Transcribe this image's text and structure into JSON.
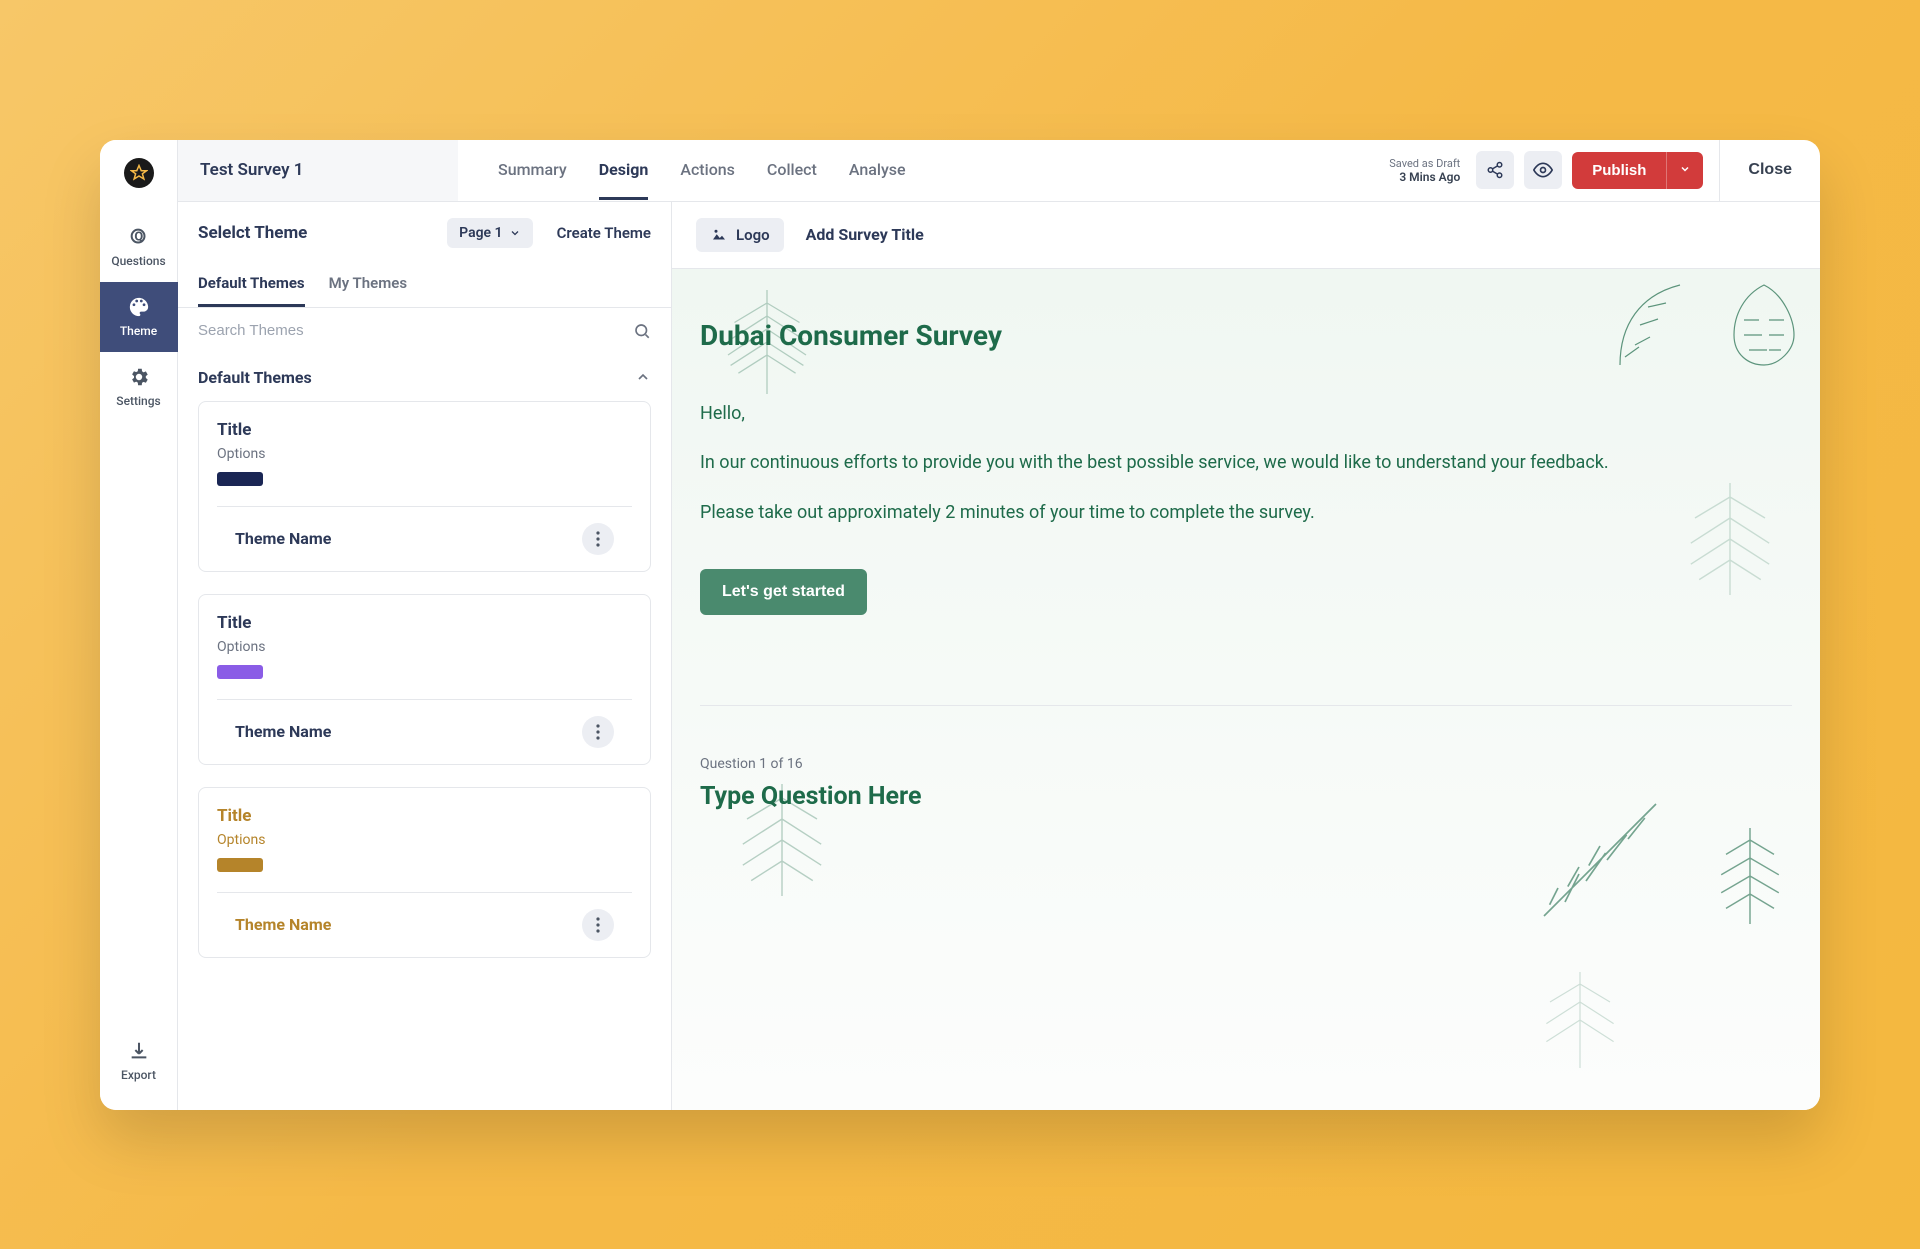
{
  "survey_name": "Test Survey 1",
  "top_tabs": [
    "Summary",
    "Design",
    "Actions",
    "Collect",
    "Analyse"
  ],
  "top_tabs_active": "Design",
  "save_status_line1": "Saved as Draft",
  "save_status_line2": "3 Mins Ago",
  "publish_label": "Publish",
  "close_label": "Close",
  "rail": [
    {
      "id": "questions",
      "label": "Questions"
    },
    {
      "id": "theme",
      "label": "Theme"
    },
    {
      "id": "settings",
      "label": "Settings"
    },
    {
      "id": "export",
      "label": "Export"
    }
  ],
  "rail_active": "theme",
  "sidebar": {
    "title": "Selelct Theme",
    "page_label": "Page 1",
    "create_theme": "Create Theme",
    "tabs": [
      "Default Themes",
      "My Themes"
    ],
    "tabs_active": "Default Themes",
    "search_placeholder": "Search Themes",
    "group_header": "Default Themes",
    "themes": [
      {
        "title": "Title",
        "options": "Options",
        "name": "Theme Name",
        "title_color": "#2d3958",
        "options_color": "#6b7280",
        "swatch": "#1a2654",
        "name_color": "#2d3958"
      },
      {
        "title": "Title",
        "options": "Options",
        "name": "Theme Name",
        "title_color": "#2d3958",
        "options_color": "#6b7280",
        "swatch": "#8a5ce6",
        "name_color": "#2d3958"
      },
      {
        "title": "Title",
        "options": "Options",
        "name": "Theme Name",
        "title_color": "#b5842a",
        "options_color": "#b5842a",
        "swatch": "#b5842a",
        "name_color": "#b5842a"
      }
    ]
  },
  "preview": {
    "logo_label": "Logo",
    "add_title": "Add Survey Title",
    "survey_title": "Dubai Consumer Survey",
    "greeting": "Hello,",
    "paragraph1": "In our continuous efforts to provide you with the best possible service, we would like to understand your feedback.",
    "paragraph2": "Please take out approximately 2 minutes of your time to complete the survey.",
    "start_button": "Let's get started",
    "question_counter": "Question 1 of 16",
    "question_placeholder": "Type Question Here"
  },
  "colors": {
    "brand_green": "#1e6b4a",
    "accent_red": "#d23b3b",
    "rail_active_bg": "#3f4d7a"
  }
}
